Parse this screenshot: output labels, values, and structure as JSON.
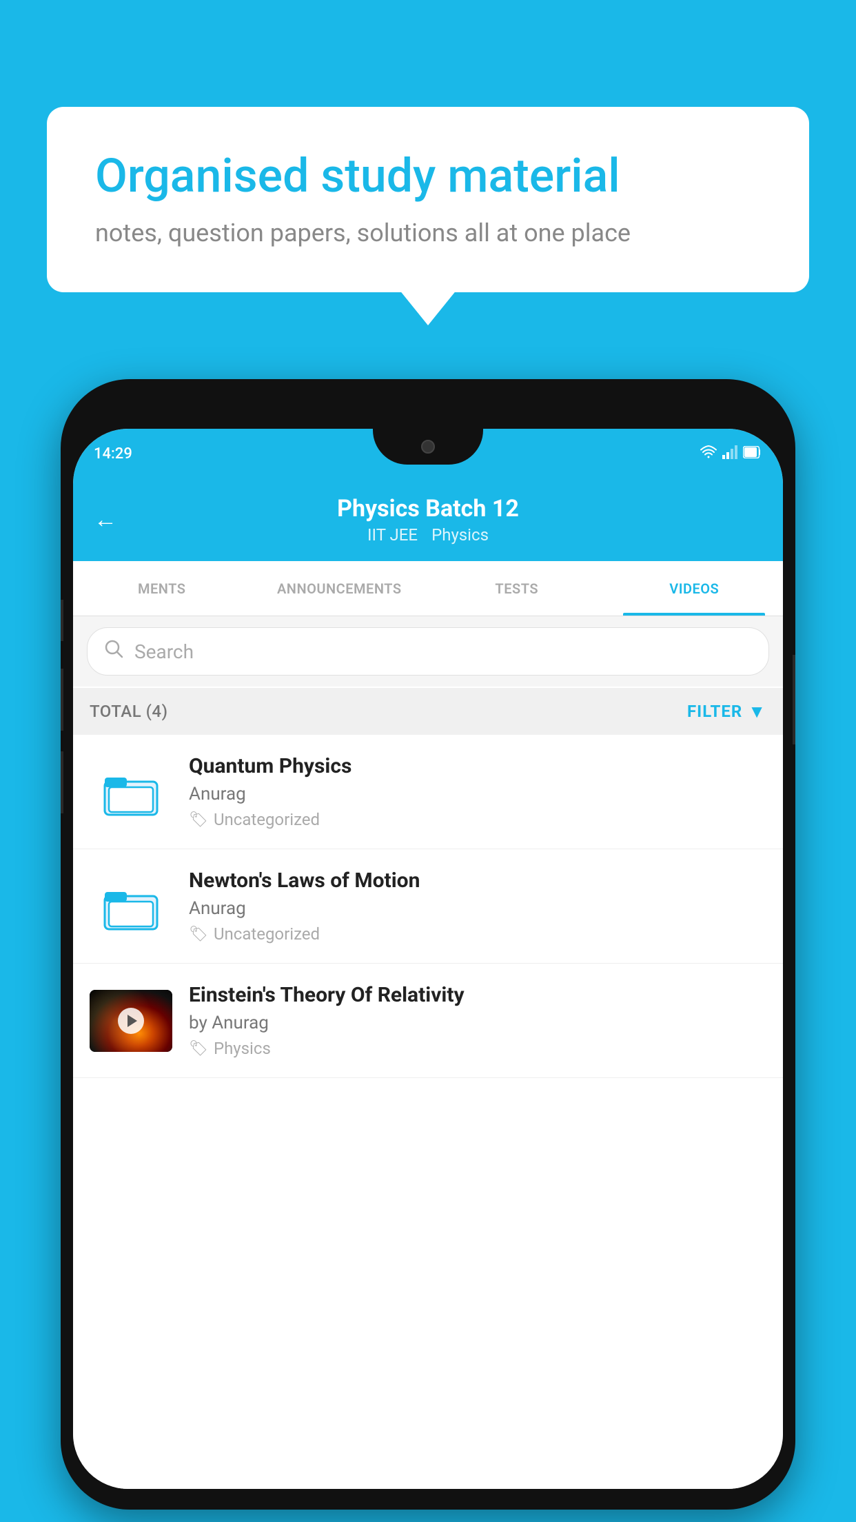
{
  "background_color": "#1ab8e8",
  "bubble": {
    "title": "Organised study material",
    "subtitle": "notes, question papers, solutions all at one place"
  },
  "phone": {
    "status_bar": {
      "time": "14:29",
      "icons": [
        "wifi",
        "signal",
        "battery"
      ]
    },
    "header": {
      "title": "Physics Batch 12",
      "subtitle_part1": "IIT JEE",
      "subtitle_part2": "Physics",
      "back_label": "←"
    },
    "tabs": [
      {
        "label": "MENTS",
        "active": false
      },
      {
        "label": "ANNOUNCEMENTS",
        "active": false
      },
      {
        "label": "TESTS",
        "active": false
      },
      {
        "label": "VIDEOS",
        "active": true
      }
    ],
    "search": {
      "placeholder": "Search"
    },
    "filter_bar": {
      "total_label": "TOTAL (4)",
      "filter_label": "FILTER"
    },
    "videos": [
      {
        "id": 1,
        "title": "Quantum Physics",
        "author": "Anurag",
        "tag": "Uncategorized",
        "has_thumb": false
      },
      {
        "id": 2,
        "title": "Newton's Laws of Motion",
        "author": "Anurag",
        "tag": "Uncategorized",
        "has_thumb": false
      },
      {
        "id": 3,
        "title": "Einstein's Theory Of Relativity",
        "author": "by Anurag",
        "tag": "Physics",
        "has_thumb": true
      }
    ]
  }
}
